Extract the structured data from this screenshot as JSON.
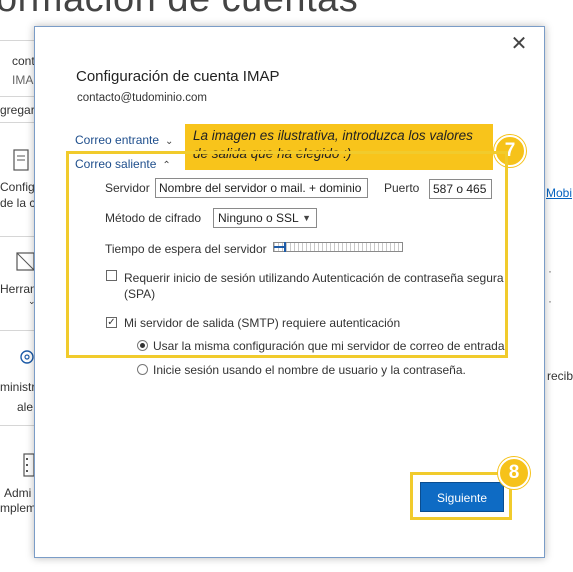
{
  "background": {
    "title": "ormación de cuentas",
    "left_items": [
      {
        "text": "cont"
      },
      {
        "text": "IMAP"
      },
      {
        "text": "gregar"
      },
      {
        "text": "Config"
      },
      {
        "text": "de la cu"
      },
      {
        "text": "Herram"
      },
      {
        "text": "ministr"
      },
      {
        "text": "ale"
      },
      {
        "text": "Admi"
      },
      {
        "text": "mpleme"
      }
    ],
    "right_items": [
      {
        "text": "Mobi"
      },
      {
        "text": "recib"
      }
    ]
  },
  "dialog": {
    "title": "Configuración de cuenta IMAP",
    "email": "contacto@tudominio.com",
    "incoming_label": "Correo entrante",
    "outgoing_label": "Correo saliente",
    "tooltip": "La imagen es ilustrativa, introduzca los valores de salida que ha elegido :)",
    "step_7": "7",
    "step_8": "8",
    "server_label": "Servidor",
    "server_value": "Nombre del servidor o mail. + dominio",
    "port_label": "Puerto",
    "port_value": "587 o 465",
    "encryption_label": "Método de cifrado",
    "encryption_value": "Ninguno o SSL",
    "timeout_label": "Tiempo de espera del servidor",
    "timeout_fraction": 0.08,
    "spa_label": "Requerir inicio de sesión utilizando Autenticación de contraseña segura (SPA)",
    "spa_checked": false,
    "smtp_auth_label": "Mi servidor de salida (SMTP) requiere autenticación",
    "smtp_auth_checked": true,
    "radio_same_label": "Usar la misma configuración que mi servidor de correo de entrada",
    "radio_login_label": "Inicie sesión usando el nombre de usuario y la contraseña.",
    "selected_radio": "same",
    "next_button": "Siguiente",
    "close_icon": "close-icon",
    "accent_color": "#f6c21a",
    "button_color": "#0e6bc4"
  }
}
